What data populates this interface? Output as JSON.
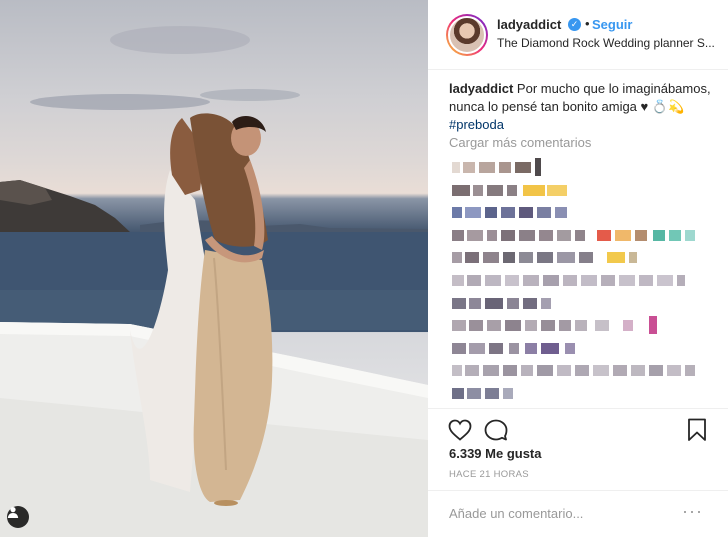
{
  "post": {
    "username": "ladyaddict",
    "follow_label": "Seguir",
    "separator": "•",
    "location": "The Diamond Rock Wedding planner S...",
    "caption_user": "ladyaddict",
    "caption_text": "Por mucho que lo imaginábamos, nunca lo pensé tan bonito amiga ♥ 💍💫",
    "caption_hashtag": "#preboda",
    "load_more": "Cargar más comentarios",
    "likes": "6.339 Me gusta",
    "timestamp": "HACE 21 HORAS",
    "comment_placeholder": "Añade un comentario...",
    "more_glyph": "···"
  },
  "icons": {
    "verified": "verified-badge-icon",
    "tag": "user-tag-icon",
    "like": "heart-icon",
    "comment": "comment-bubble-icon",
    "save": "bookmark-icon",
    "more": "more-options-icon"
  },
  "colors": {
    "accent_blue": "#3897f0",
    "text": "#262626",
    "muted": "#999999",
    "hashtag": "#003569",
    "divider": "#efefef"
  }
}
